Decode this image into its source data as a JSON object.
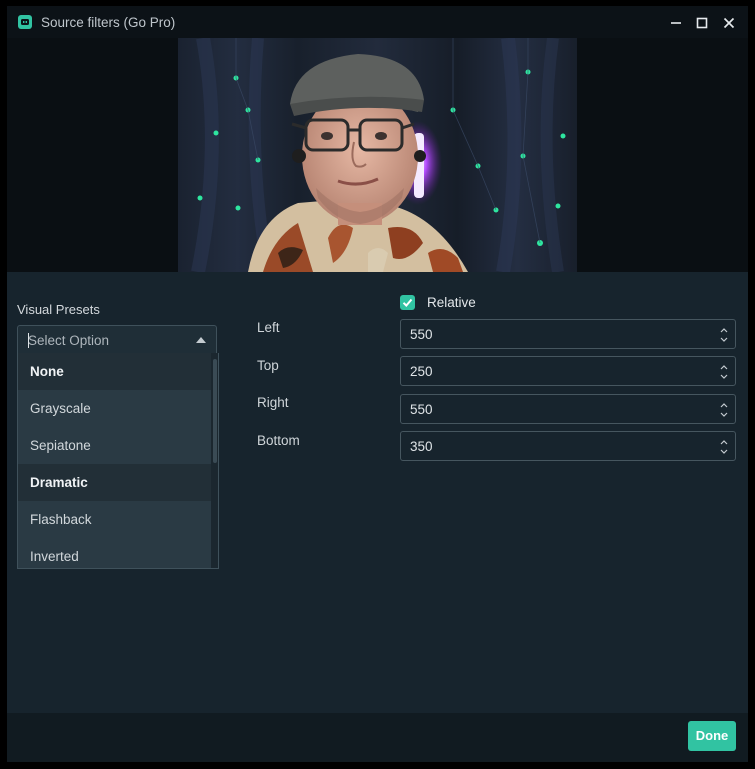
{
  "window": {
    "title": "Source filters (Go Pro)",
    "accent_color": "#31c3a2",
    "icons": {
      "app": "streamlabs-icon",
      "minimize": "minimize-icon",
      "maximize": "maximize-icon",
      "close": "close-icon"
    }
  },
  "presets": {
    "label": "Visual Presets",
    "placeholder": "Select Option",
    "options": [
      {
        "label": "None"
      },
      {
        "label": "Grayscale"
      },
      {
        "label": "Sepiatone"
      },
      {
        "label": "Dramatic"
      },
      {
        "label": "Flashback"
      },
      {
        "label": "Inverted"
      }
    ]
  },
  "crop": {
    "relative_label": "Relative",
    "relative_checked": true,
    "fields": [
      {
        "label": "Left",
        "value": "550"
      },
      {
        "label": "Top",
        "value": "250"
      },
      {
        "label": "Right",
        "value": "550"
      },
      {
        "label": "Bottom",
        "value": "350"
      }
    ]
  },
  "footer": {
    "done_label": "Done"
  }
}
